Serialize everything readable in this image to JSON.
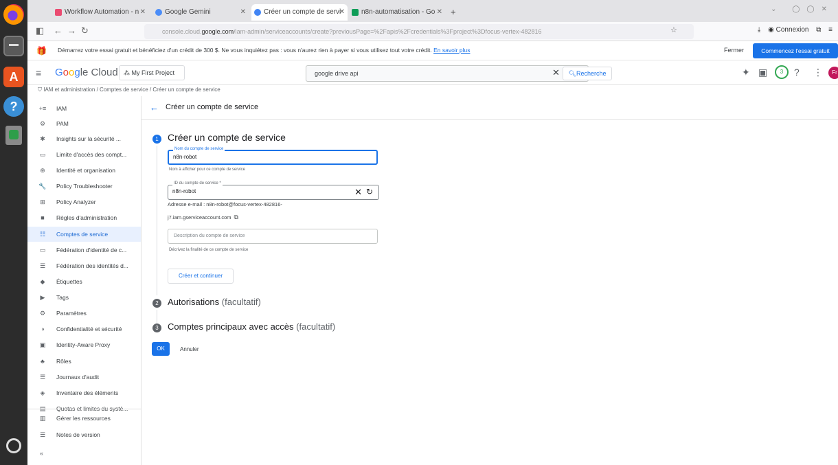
{
  "browser": {
    "tabs": [
      {
        "label": "Workflow Automation - n",
        "active": false
      },
      {
        "label": "Google Gemini",
        "active": false
      },
      {
        "label": "Créer un compte de servi",
        "active": true
      },
      {
        "label": "n8n-automatisation - Go",
        "active": false
      }
    ],
    "new_tab": "+",
    "url_prefix": "console.cloud.",
    "url_domain": "google.com",
    "url_rest": "/iam-admin/serviceaccounts/create?previousPage=%2Fapis%2Fcredentials%3Fproject%3Dfocus-vertex-482816",
    "nav_right": "Connexion"
  },
  "trial_banner": {
    "text": "Démarrez votre essai gratuit et bénéficiez d'un crédit de 300 $. Ne vous inquiétez pas : vous n'aurez rien à payer si vous utilisez tout votre crédit.",
    "link": "En savoir plus",
    "close_label": "Fermer",
    "start_label": "Commencez l'essai gratuit"
  },
  "header": {
    "logo": [
      "G",
      "o",
      "o",
      "g",
      "le Cloud"
    ],
    "project": "My First Project",
    "search_value": "google drive api",
    "search_button": "Recherche",
    "status_circle": "3",
    "avatar_letter": "Fr"
  },
  "breadcrumb": "IAM et administration  /  Comptes de service  /  Créer un compte de service",
  "sidebar": {
    "items": [
      {
        "icon": "+≡",
        "label": "IAM"
      },
      {
        "icon": "⚙",
        "label": "PAM"
      },
      {
        "icon": "✱",
        "label": "Insights sur la sécurité ..."
      },
      {
        "icon": "▭",
        "label": "Limite d'accès des compt..."
      },
      {
        "icon": "⊕",
        "label": "Identité et organisation"
      },
      {
        "icon": "🔧",
        "label": "Policy Troubleshooter"
      },
      {
        "icon": "⊞",
        "label": "Policy Analyzer"
      },
      {
        "icon": "■",
        "label": "Règles d'administration"
      },
      {
        "icon": "☷",
        "label": "Comptes de service"
      },
      {
        "icon": "▭",
        "label": "Fédération d'identité de c..."
      },
      {
        "icon": "☰",
        "label": "Fédération des identités d..."
      },
      {
        "icon": "◆",
        "label": "Étiquettes"
      },
      {
        "icon": "▶",
        "label": "Tags"
      },
      {
        "icon": "⚙",
        "label": "Paramètres"
      },
      {
        "icon": "◑",
        "label": "Confidentialité et sécurité"
      },
      {
        "icon": "▣",
        "label": "Identity-Aware Proxy"
      },
      {
        "icon": "♣",
        "label": "Rôles"
      },
      {
        "icon": "☰",
        "label": "Journaux d'audit"
      },
      {
        "icon": "◈",
        "label": "Inventaire des éléments"
      },
      {
        "icon": "▤",
        "label": "Quotas et limites du systè..."
      },
      {
        "icon": "▥",
        "label": "Gérer les ressources"
      },
      {
        "icon": "☰",
        "label": "Notes de version"
      }
    ],
    "active_index": 8,
    "collapse": "«"
  },
  "page": {
    "title": "Créer un compte de service",
    "step1": {
      "num": "1",
      "title": "Créer un compte de service"
    },
    "name_field": {
      "label": "Nom du compte de service",
      "value": "n8n-robot",
      "hint": "Nom à afficher pour ce compte de service"
    },
    "id_field": {
      "label": "ID du compte de service *",
      "value": "n8n-robot"
    },
    "email_line1": "Adresse e-mail : n8n-robot@focus-vertex-482816-",
    "email_line2": "j7.iam.gserviceaccount.com",
    "desc_field": {
      "placeholder": "Description du compte de service",
      "hint": "Décrivez la finalité de ce compte de service"
    },
    "create_continue": "Créer et continuer",
    "step2": {
      "num": "2",
      "title": "Autorisations",
      "optional": "(facultatif)"
    },
    "step3": {
      "num": "3",
      "title": "Comptes principaux avec accès",
      "optional": "(facultatif)"
    },
    "ok": "OK",
    "cancel": "Annuler"
  },
  "colors": {
    "accent": "#1a73e8",
    "active_bg": "#e8f0fe"
  }
}
